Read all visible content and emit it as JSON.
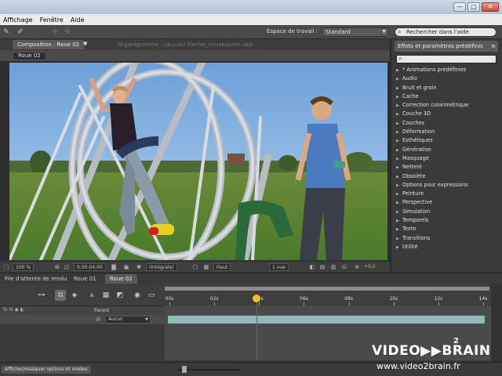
{
  "menu": [
    "Affichage",
    "Fenêtre",
    "Aide"
  ],
  "window_buttons": {
    "minimize": "—",
    "maximize": "□",
    "close": "✕"
  },
  "toolbar": {
    "workspace_label": "Espace de travail :",
    "workspace_value": "Standard",
    "help_search": "Rechercher dans l'aide"
  },
  "composition": {
    "tab": "Composition : Roue 02",
    "info": "Organigramme : (aucun) Fleche_nouveaurèe.aep",
    "subtab": "Roue 02",
    "zoom": "100 %",
    "timecode": "0;00;04;00",
    "resolution": "(Intégrale)",
    "view": "Haut",
    "views_count": "1 vue",
    "exposure": "+0,0"
  },
  "effects": {
    "title": "Effets et paramètres prédéfinis",
    "items": [
      "* Animations prédéfinies",
      "Audio",
      "Bruit et grain",
      "Cache",
      "Correction colorimétrique",
      "Couche 3D",
      "Couches",
      "Déformation",
      "Esthétiques",
      "Génération",
      "Masquage",
      "Netteté",
      "Obsolète",
      "Options pour expressions",
      "Peinture",
      "Perspective",
      "Simulation",
      "Temporels",
      "Texte",
      "Transitions",
      "Utilité"
    ]
  },
  "timeline": {
    "tabs": [
      "File d'attente de rendu",
      "Roue 01",
      "Roue 02"
    ],
    "ruler": [
      "00s",
      "02s",
      "04s",
      "06s",
      "08s",
      "10s",
      "12s",
      "14s"
    ],
    "parent_header": "Parent",
    "parent_value": "Aucun",
    "footer_button": "Afficher/masquer options et modes"
  },
  "watermark": {
    "logo_left": "VIDEO",
    "logo_mid": "▶▶",
    "logo_right": "BRAIN",
    "logo_sup": "2",
    "url": "www.video2brain.fr"
  }
}
